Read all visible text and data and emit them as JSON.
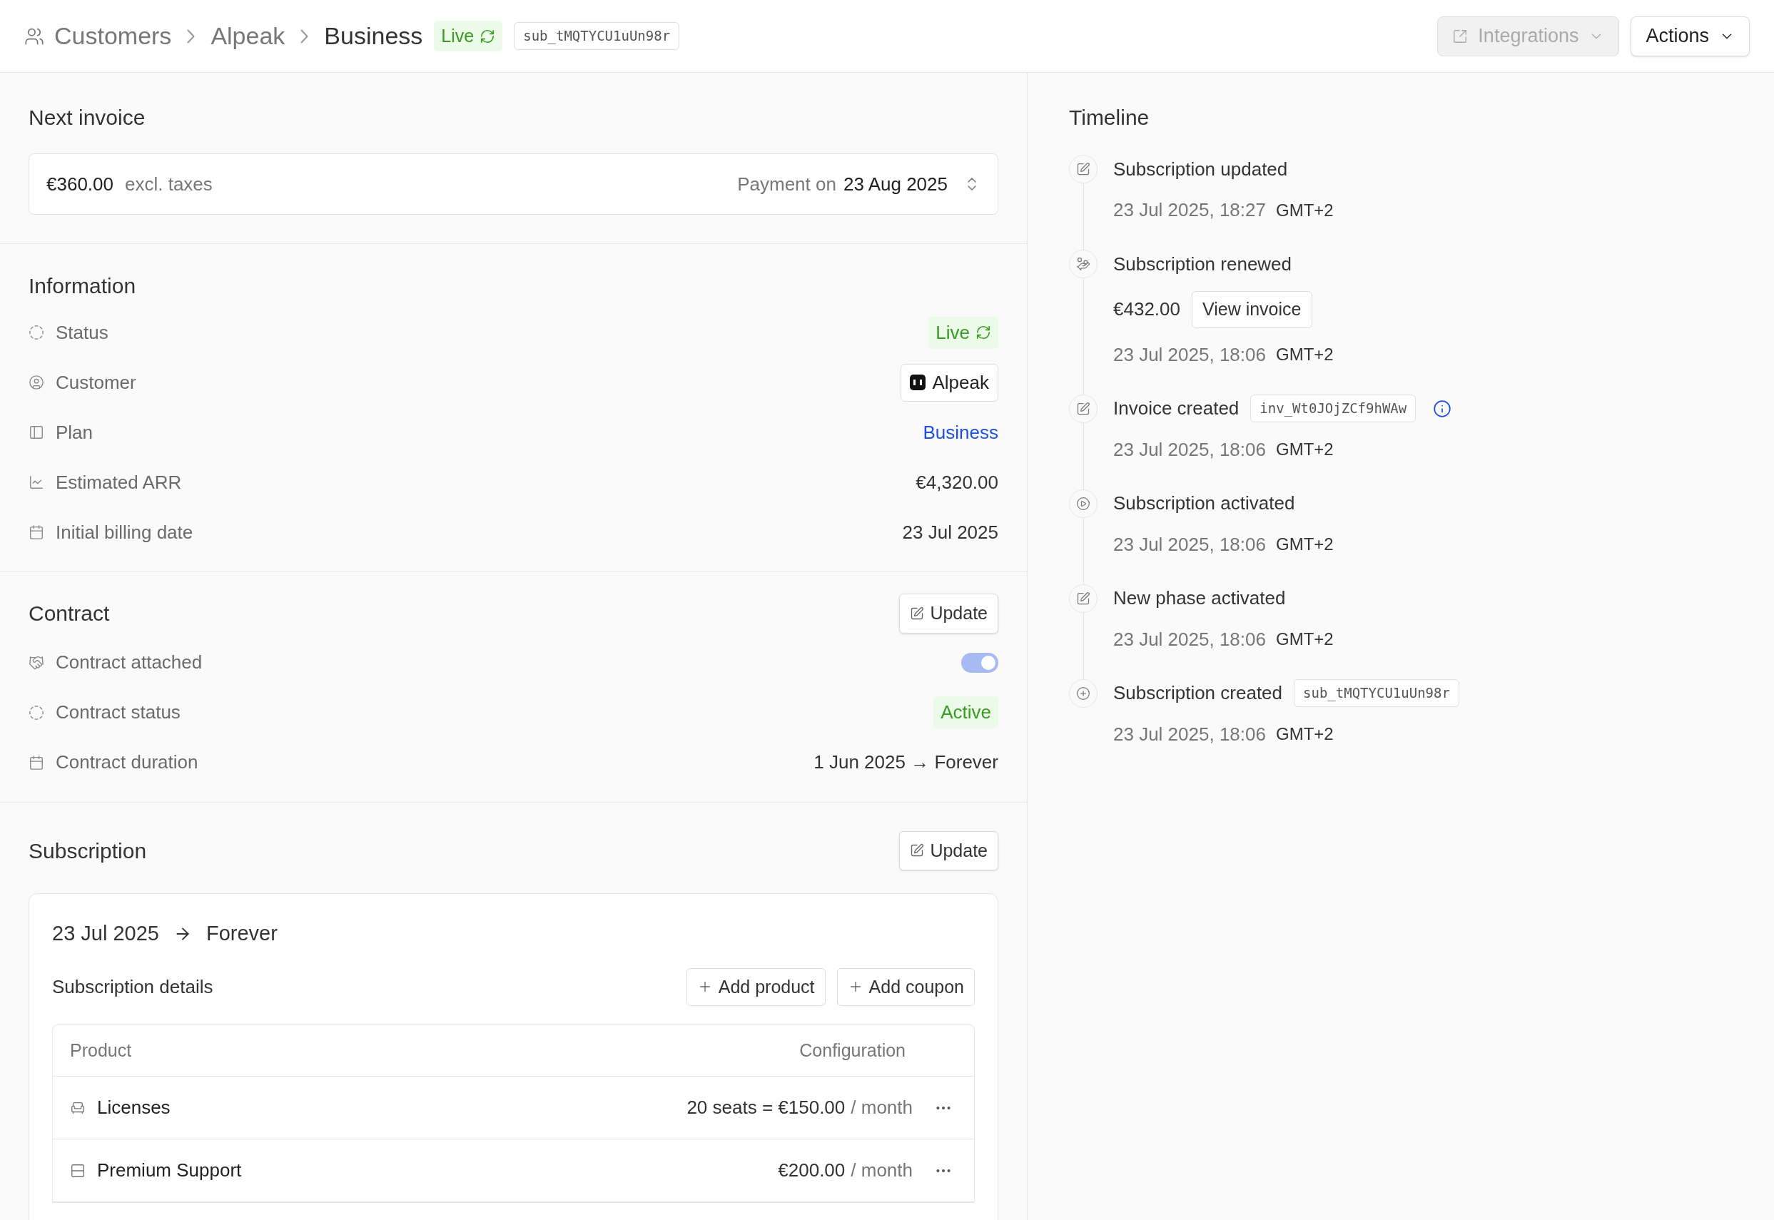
{
  "header": {
    "breadcrumb": [
      {
        "label": "Customers"
      },
      {
        "label": "Alpeak"
      },
      {
        "label": "Business"
      }
    ],
    "status": "Live",
    "id_chip": "sub_tMQTYCU1uUn98r",
    "buttons": [
      {
        "label": "Integrations",
        "disabled": true
      },
      {
        "label": "Actions",
        "disabled": false
      }
    ]
  },
  "next_invoice": {
    "title": "Next invoice",
    "amount": "€360.00",
    "amount_note": "excl. taxes",
    "payment_label": "Payment on",
    "payment_date": "23 Aug 2025"
  },
  "information": {
    "title": "Information",
    "rows": [
      {
        "label": "Status",
        "kind": "badge",
        "value": "Live"
      },
      {
        "label": "Customer",
        "kind": "chip",
        "value": "Alpeak"
      },
      {
        "label": "Plan",
        "kind": "link",
        "value": "Business"
      },
      {
        "label": "Estimated ARR",
        "kind": "text",
        "value": "€4,320.00"
      },
      {
        "label": "Initial billing date",
        "kind": "text",
        "value": "23 Jul 2025"
      }
    ]
  },
  "contract": {
    "title": "Contract",
    "button": "Update",
    "rows": [
      {
        "label": "Contract attached",
        "kind": "toggle",
        "on": true
      },
      {
        "label": "Contract status",
        "kind": "status",
        "value": "Active"
      },
      {
        "label": "Contract duration",
        "kind": "text",
        "value": "1 Jun 2025 → Forever"
      }
    ]
  },
  "subscription": {
    "title": "Subscription",
    "button": "Update",
    "start": "23 Jul 2025",
    "end": "Forever",
    "details_title": "Subscription details",
    "actions": [
      "Add product",
      "Add coupon"
    ],
    "table": {
      "columns": [
        "Product",
        "Configuration"
      ],
      "rows": [
        {
          "product": "Licenses",
          "config": "20 seats = €150.00",
          "unit": "/ month"
        },
        {
          "product": "Premium Support",
          "config": "€200.00",
          "unit": "/ month"
        }
      ]
    }
  },
  "timeline": {
    "title": "Timeline",
    "events": [
      {
        "title": "Subscription updated",
        "date": "23 Jul 2025, 18:27",
        "tz": "GMT+2"
      },
      {
        "title": "Subscription renewed",
        "amount": "€432.00",
        "button": "View invoice",
        "date": "23 Jul 2025, 18:06",
        "tz": "GMT+2"
      },
      {
        "title": "Invoice created",
        "chip": "inv_Wt0JOjZCf9hWAw",
        "info": true,
        "date": "23 Jul 2025, 18:06",
        "tz": "GMT+2"
      },
      {
        "title": "Subscription activated",
        "date": "23 Jul 2025, 18:06",
        "tz": "GMT+2"
      },
      {
        "title": "New phase activated",
        "date": "23 Jul 2025, 18:06",
        "tz": "GMT+2"
      },
      {
        "title": "Subscription created",
        "chip": "sub_tMQTYCU1uUn98r",
        "date": "23 Jul 2025, 18:06",
        "tz": "GMT+2"
      }
    ]
  }
}
